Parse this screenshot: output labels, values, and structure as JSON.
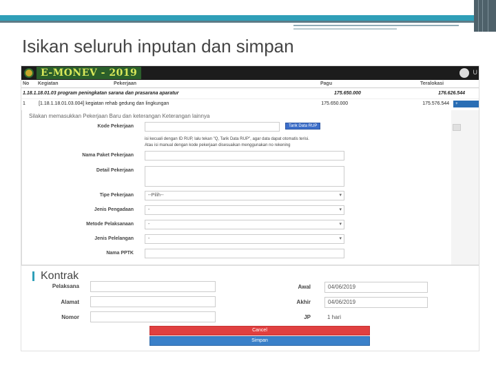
{
  "slide": {
    "title": "Isikan seluruh inputan dan simpan"
  },
  "app": {
    "logo": "E-MONEV - 2019",
    "user_text": "U",
    "table": {
      "headers": [
        "No",
        "Kegiatan",
        "Pekerjaan",
        "Pagu",
        "Teralokasi"
      ],
      "program_row": {
        "kegiatan": "1.18.1.18.01.03 program peningkatan sarana dan prasarana aparatur",
        "pagu": "175.650.000",
        "teralokasi": "176.626.544"
      },
      "kegiatan_row": {
        "no": "1",
        "desc": "[1.18.1.18.01.03.004] kegiatan rehab gedung dan lingkungan",
        "pagu": "175.650.000",
        "teralokasi": "175.576.544",
        "button": "+ Pekerjaan"
      }
    },
    "form": {
      "panel_title": "Silakan memasukkan Pekerjaan Baru dan keterangan Keterangan lainnya",
      "kode_label": "Kode Pekerjaan",
      "tarik_button": "Tarik Data RUP",
      "help_line1": "isi kecuali dengan ID RUP, lalu tekan \"Q, Tarik Data RUP\", agar data dapat otomatis terisi.",
      "help_line2": "Atau isi manual dengan kode pekerjaan disesuaikan menggunakan no rekening",
      "nama_label": "Nama Paket Pekerjaan",
      "detail_label": "Detail Pekerjaan",
      "tipe_label": "Tipe Pekerjaan",
      "tipe_value": "--Pilih--",
      "pengadaan_label": "Jenis Pengadaan",
      "pengadaan_value": "-",
      "metode_label": "Metode Pelaksanaan",
      "metode_value": "-",
      "pelelangan_label": "Jenis Pelelangan",
      "pelelangan_value": "-",
      "pptk_label": "Nama PPTK"
    }
  },
  "kontrak": {
    "title": "Kontrak",
    "pelaksana_label": "Pelaksana",
    "alamat_label": "Alamat",
    "nomor_label": "Nomor",
    "awal_label": "Awal",
    "awal_value": "04/06/2019",
    "akhir_label": "Akhir",
    "akhir_value": "04/06/2019",
    "jp_label": "JP",
    "jp_value": "1 hari",
    "cancel_label": "Cancel",
    "simpan_label": "Simpan"
  },
  "colors": {
    "accent": "#2f9fb8",
    "header": "#1c1c1c",
    "cancel": "#e04040",
    "save": "#3a80c9"
  }
}
